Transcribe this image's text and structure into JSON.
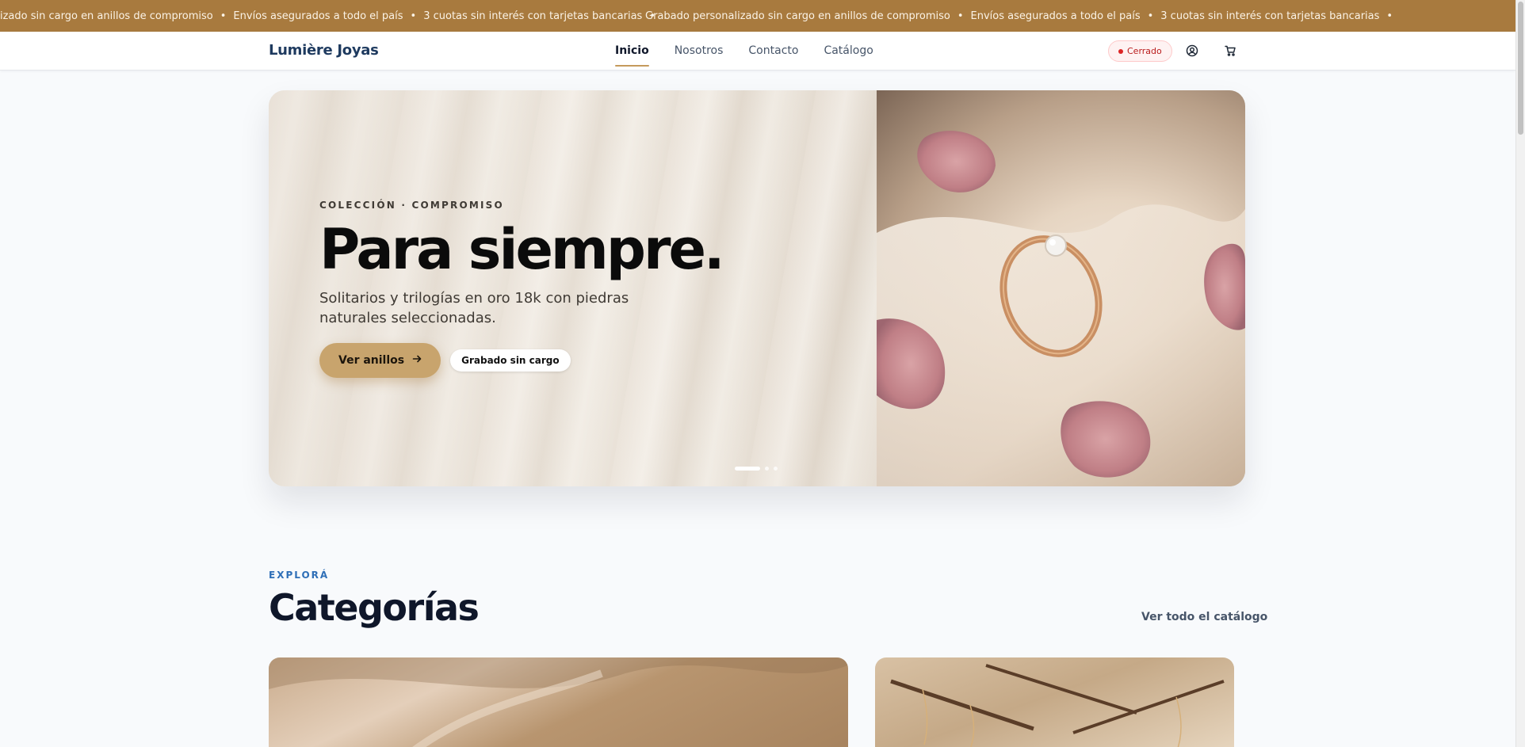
{
  "announcement": {
    "items": [
      "Grabado personalizado sin cargo en anillos de compromiso",
      "Envíos asegurados a todo el país",
      "3 cuotas sin interés con tarjetas bancarias"
    ],
    "separator": "•",
    "first_item_visible": "izado sin cargo en anillos de compromiso"
  },
  "nav": {
    "brand": "Lumière Joyas",
    "links": [
      "Inicio",
      "Nosotros",
      "Contacto",
      "Catálogo"
    ],
    "active_link": "Inicio",
    "status": "Cerrado",
    "icons": [
      "user-circle-icon",
      "cart-icon"
    ]
  },
  "hero": {
    "eyebrow": "COLECCIÓN · COMPROMISO",
    "title": "Para siempre.",
    "subtitle": "Solitarios y trilogías en oro 18k con piedras naturales seleccionadas.",
    "primary_cta": "Ver anillos",
    "primary_cta_icon": "arrow-right-icon",
    "secondary_cta": "Grabado sin cargo",
    "slides_total": 3,
    "active_slide": 1
  },
  "categories": {
    "eyebrow": "EXPLORÁ",
    "title": "Categorías",
    "view_all": "Ver todo el catálogo"
  },
  "colors": {
    "announcement_bg": "#a87a3e",
    "brand_text": "#1e3a5f",
    "primary_button": "#c8a46d",
    "status_red": "#dc2626",
    "eyebrow_blue": "#2f6fb7"
  }
}
